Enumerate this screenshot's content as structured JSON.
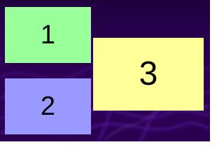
{
  "background": {
    "base_color": "#2a0050",
    "smoke_color": "#8a3cff"
  },
  "tiles": [
    {
      "label": "1",
      "color": "#99ff99"
    },
    {
      "label": "2",
      "color": "#9999ff"
    },
    {
      "label": "3",
      "color": "#ffff99"
    }
  ]
}
